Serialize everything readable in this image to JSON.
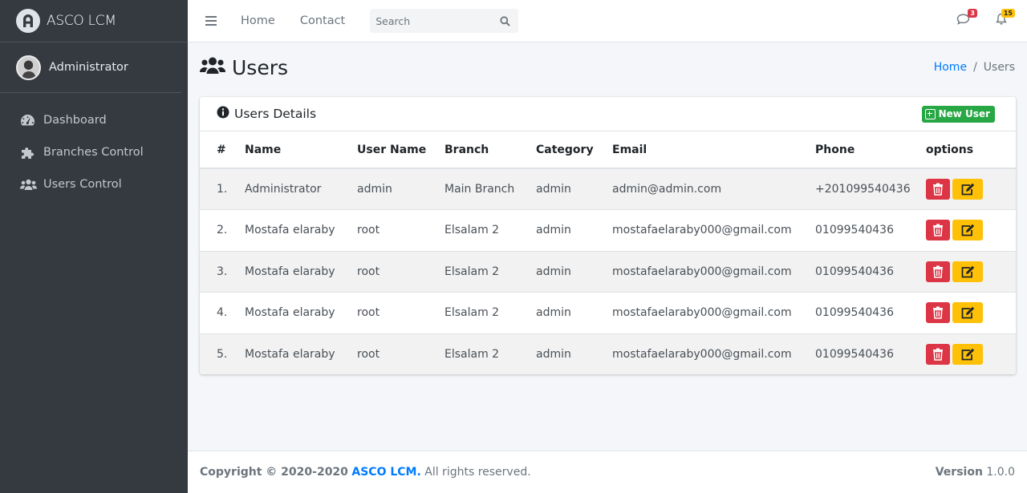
{
  "brand": {
    "name": "ASCO LCM"
  },
  "user": {
    "name": "Administrator"
  },
  "sidebar": {
    "items": [
      {
        "label": "Dashboard",
        "icon": "tachometer-icon"
      },
      {
        "label": "Branches Control",
        "icon": "puzzle-icon"
      },
      {
        "label": "Users Control",
        "icon": "users-icon"
      }
    ]
  },
  "topbar": {
    "links": [
      "Home",
      "Contact"
    ],
    "search_placeholder": "Search",
    "messages_count": "3",
    "notifications_count": "15"
  },
  "page": {
    "title": "Users",
    "breadcrumb": {
      "home": "Home",
      "current": "Users"
    }
  },
  "card": {
    "title": "Users Details",
    "new_user_label": "New User",
    "columns": [
      "#",
      "Name",
      "User Name",
      "Branch",
      "Category",
      "Email",
      "Phone",
      "options"
    ],
    "rows": [
      [
        "1.",
        "Administrator",
        "admin",
        "Main Branch",
        "admin",
        "admin@admin.com",
        "+201099540436"
      ],
      [
        "2.",
        "Mostafa elaraby",
        "root",
        "Elsalam 2",
        "admin",
        "mostafaelaraby000@gmail.com",
        "01099540436"
      ],
      [
        "3.",
        "Mostafa elaraby",
        "root",
        "Elsalam 2",
        "admin",
        "mostafaelaraby000@gmail.com",
        "01099540436"
      ],
      [
        "4.",
        "Mostafa elaraby",
        "root",
        "Elsalam 2",
        "admin",
        "mostafaelaraby000@gmail.com",
        "01099540436"
      ],
      [
        "5.",
        "Mostafa elaraby",
        "root",
        "Elsalam 2",
        "admin",
        "mostafaelaraby000@gmail.com",
        "01099540436"
      ]
    ]
  },
  "footer": {
    "copyright_prefix": "Copyright © 2020-2020",
    "link": "ASCO LCM.",
    "suffix": "All rights reserved.",
    "version_label": "Version",
    "version": "1.0.0"
  },
  "colors": {
    "sidebar_bg": "#343a40",
    "primary": "#007bff",
    "success": "#28a745",
    "danger": "#dc3545",
    "warning": "#ffc107"
  }
}
